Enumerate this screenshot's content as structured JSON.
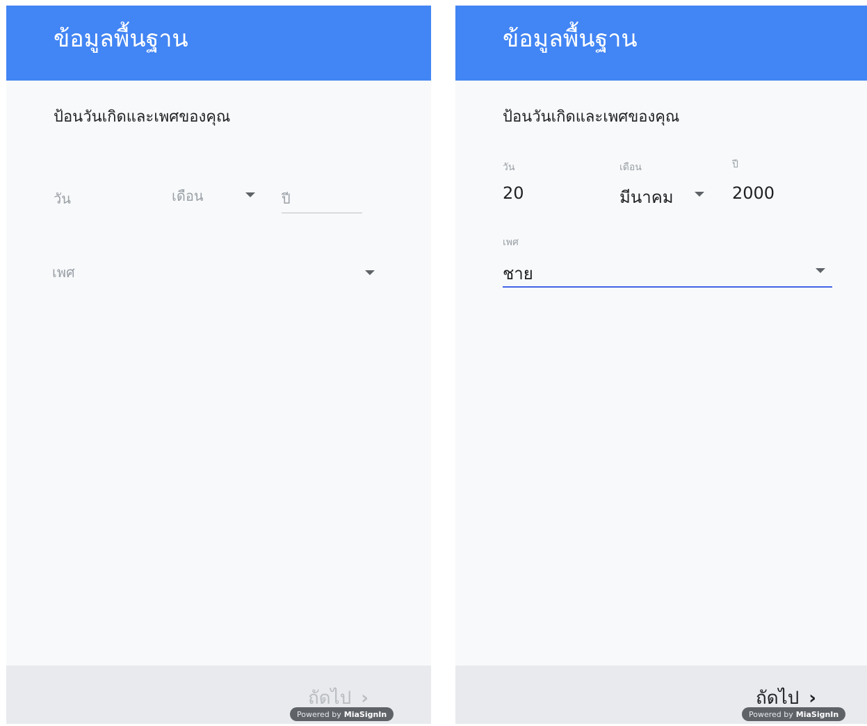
{
  "left": {
    "appbar_title": "ข้อมูลพื้นฐาน",
    "prompt": "ป้อนวันเกิดและเพศของคุณ",
    "day_label": "วัน",
    "month_label": "เดือน",
    "year_label": "ปี",
    "gender_label": "เพศ",
    "next_label": "ถัดไป",
    "powered_label": "Powered by",
    "powered_brand": "MiaSignIn"
  },
  "right": {
    "appbar_title": "ข้อมูลพื้นฐาน",
    "prompt": "ป้อนวันเกิดและเพศของคุณ",
    "day_label": "วัน",
    "day_value": "20",
    "month_label": "เดือน",
    "month_value": "มีนาคม",
    "year_label": "ปี",
    "year_value": "2000",
    "gender_label": "เพศ",
    "gender_value": "ชาย",
    "next_label": "ถัดไป",
    "powered_label": "Powered by",
    "powered_brand": "MiaSignIn"
  },
  "colors": {
    "appbar": "#4285f4",
    "active_underline": "#4064e6",
    "bottom_bar": "#e8eaed"
  }
}
